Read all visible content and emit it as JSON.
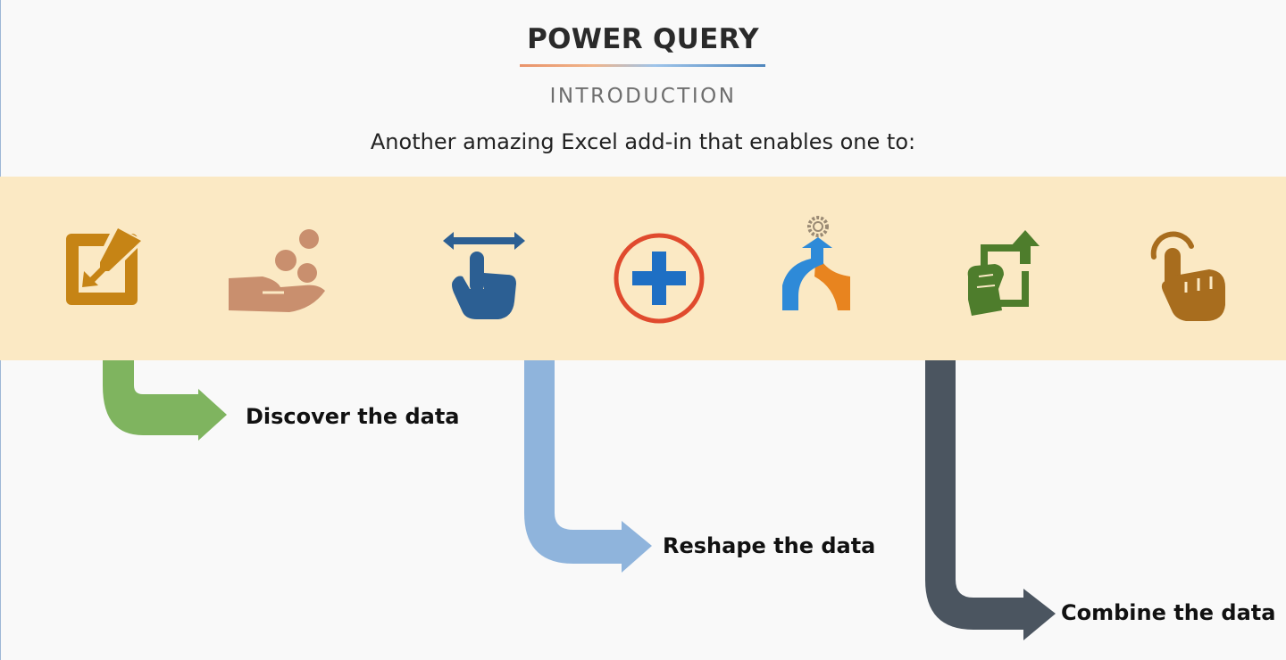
{
  "header": {
    "title": "POWER QUERY",
    "subtitle": "INTRODUCTION",
    "lead": "Another amazing Excel add-in that enables one to:"
  },
  "icons": [
    {
      "name": "edit-checkbox-icon",
      "color": "#c68415"
    },
    {
      "name": "hand-coins-icon",
      "color": "#c98f6e"
    },
    {
      "name": "swipe-gesture-icon",
      "color": "#2c5f93"
    },
    {
      "name": "add-circle-icon",
      "color": "#e04a2e"
    },
    {
      "name": "merge-arrows-icon",
      "color": "#2e8ad8"
    },
    {
      "name": "hand-upload-icon",
      "color": "#4e7d2c"
    },
    {
      "name": "tap-finger-icon",
      "color": "#a86d1e"
    }
  ],
  "steps": [
    {
      "label": "Discover the data",
      "color": "#7fb45f"
    },
    {
      "label": "Reshape the data",
      "color": "#8fb4dc"
    },
    {
      "label": "Combine the data",
      "color": "#4b5560"
    }
  ],
  "colors": {
    "band": "#fbe9c4",
    "background": "#f9f9f9"
  }
}
